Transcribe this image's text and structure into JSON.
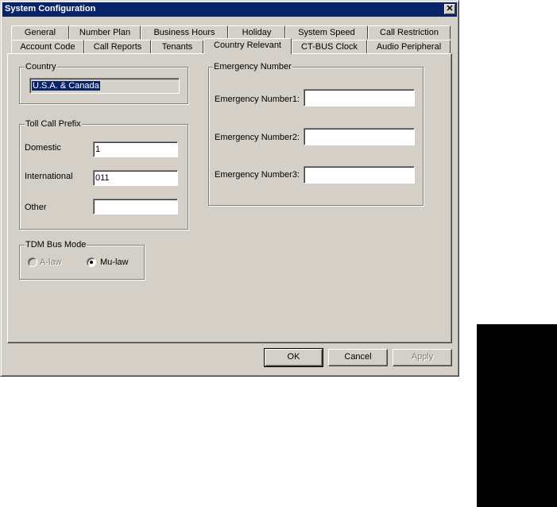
{
  "window": {
    "title": "System Configuration",
    "close_glyph": "✕"
  },
  "tabs_row_back": [
    "General",
    "Number Plan",
    "Business Hours",
    "Holiday",
    "System Speed",
    "Call Restriction"
  ],
  "tabs_row_front": [
    "Account Code",
    "Call Reports",
    "Tenants",
    "Country Relevant",
    "CT-BUS Clock",
    "Audio Peripheral"
  ],
  "active_tab": "Country Relevant",
  "country": {
    "legend": "Country",
    "value": "U.S.A. & Canada"
  },
  "toll_prefix": {
    "legend": "Toll Call Prefix",
    "domestic_label": "Domestic",
    "domestic_value": "1",
    "international_label": "International",
    "international_value": "011",
    "other_label": "Other",
    "other_value": ""
  },
  "tdm": {
    "legend": "TDM Bus Mode",
    "alaw_label": "A-law",
    "mulaw_label": "Mu-law",
    "selected": "Mu-law"
  },
  "emergency": {
    "legend": "Emergency Number",
    "label1": "Emergency Number1:",
    "value1": "",
    "label2": "Emergency Number2:",
    "value2": "",
    "label3": "Emergency Number3:",
    "value3": ""
  },
  "buttons": {
    "ok": "OK",
    "cancel": "Cancel",
    "apply": "Apply"
  }
}
